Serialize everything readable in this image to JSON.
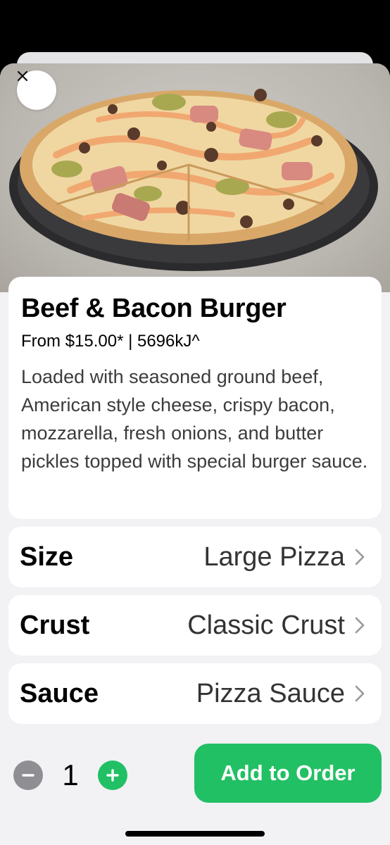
{
  "product": {
    "name": "Beef & Bacon Burger",
    "meta": "From $15.00* | 5696kJ^",
    "description": "Loaded with seasoned ground beef, American style cheese, crispy bacon, mozzarella, fresh onions, and butter pickles topped with special burger sauce."
  },
  "options": [
    {
      "label": "Size",
      "value": "Large Pizza"
    },
    {
      "label": "Crust",
      "value": "Classic Crust"
    },
    {
      "label": "Sauce",
      "value": "Pizza Sauce"
    }
  ],
  "order": {
    "quantity": "1",
    "add_label": "Add to Order"
  },
  "colors": {
    "accent": "#22c064",
    "muted_button": "#8e8e93",
    "background": "#f2f2f5"
  },
  "icons": {
    "close": "close-icon",
    "chevron": "chevron-right-icon",
    "minus": "minus-icon",
    "plus": "plus-icon"
  }
}
